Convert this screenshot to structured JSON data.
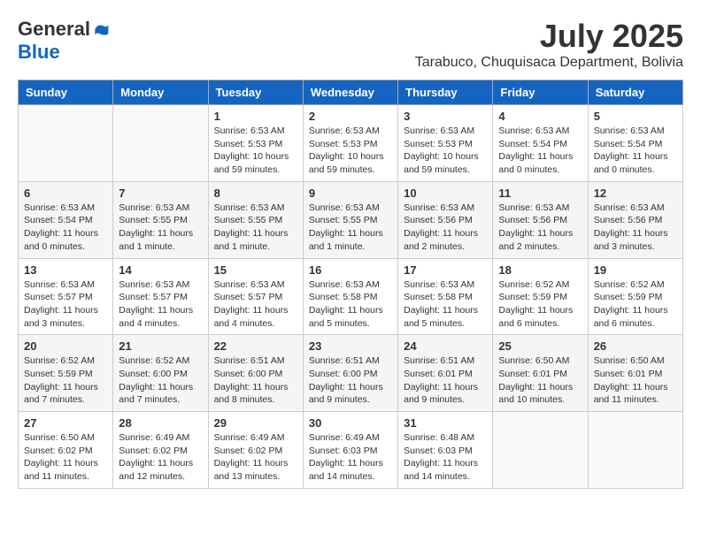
{
  "logo": {
    "general": "General",
    "blue": "Blue"
  },
  "title": {
    "month_year": "July 2025",
    "location": "Tarabuco, Chuquisaca Department, Bolivia"
  },
  "days_of_week": [
    "Sunday",
    "Monday",
    "Tuesday",
    "Wednesday",
    "Thursday",
    "Friday",
    "Saturday"
  ],
  "weeks": [
    [
      {
        "day": "",
        "sunrise": "",
        "sunset": "",
        "daylight": ""
      },
      {
        "day": "",
        "sunrise": "",
        "sunset": "",
        "daylight": ""
      },
      {
        "day": "1",
        "sunrise": "Sunrise: 6:53 AM",
        "sunset": "Sunset: 5:53 PM",
        "daylight": "Daylight: 10 hours and 59 minutes."
      },
      {
        "day": "2",
        "sunrise": "Sunrise: 6:53 AM",
        "sunset": "Sunset: 5:53 PM",
        "daylight": "Daylight: 10 hours and 59 minutes."
      },
      {
        "day": "3",
        "sunrise": "Sunrise: 6:53 AM",
        "sunset": "Sunset: 5:53 PM",
        "daylight": "Daylight: 10 hours and 59 minutes."
      },
      {
        "day": "4",
        "sunrise": "Sunrise: 6:53 AM",
        "sunset": "Sunset: 5:54 PM",
        "daylight": "Daylight: 11 hours and 0 minutes."
      },
      {
        "day": "5",
        "sunrise": "Sunrise: 6:53 AM",
        "sunset": "Sunset: 5:54 PM",
        "daylight": "Daylight: 11 hours and 0 minutes."
      }
    ],
    [
      {
        "day": "6",
        "sunrise": "Sunrise: 6:53 AM",
        "sunset": "Sunset: 5:54 PM",
        "daylight": "Daylight: 11 hours and 0 minutes."
      },
      {
        "day": "7",
        "sunrise": "Sunrise: 6:53 AM",
        "sunset": "Sunset: 5:55 PM",
        "daylight": "Daylight: 11 hours and 1 minute."
      },
      {
        "day": "8",
        "sunrise": "Sunrise: 6:53 AM",
        "sunset": "Sunset: 5:55 PM",
        "daylight": "Daylight: 11 hours and 1 minute."
      },
      {
        "day": "9",
        "sunrise": "Sunrise: 6:53 AM",
        "sunset": "Sunset: 5:55 PM",
        "daylight": "Daylight: 11 hours and 1 minute."
      },
      {
        "day": "10",
        "sunrise": "Sunrise: 6:53 AM",
        "sunset": "Sunset: 5:56 PM",
        "daylight": "Daylight: 11 hours and 2 minutes."
      },
      {
        "day": "11",
        "sunrise": "Sunrise: 6:53 AM",
        "sunset": "Sunset: 5:56 PM",
        "daylight": "Daylight: 11 hours and 2 minutes."
      },
      {
        "day": "12",
        "sunrise": "Sunrise: 6:53 AM",
        "sunset": "Sunset: 5:56 PM",
        "daylight": "Daylight: 11 hours and 3 minutes."
      }
    ],
    [
      {
        "day": "13",
        "sunrise": "Sunrise: 6:53 AM",
        "sunset": "Sunset: 5:57 PM",
        "daylight": "Daylight: 11 hours and 3 minutes."
      },
      {
        "day": "14",
        "sunrise": "Sunrise: 6:53 AM",
        "sunset": "Sunset: 5:57 PM",
        "daylight": "Daylight: 11 hours and 4 minutes."
      },
      {
        "day": "15",
        "sunrise": "Sunrise: 6:53 AM",
        "sunset": "Sunset: 5:57 PM",
        "daylight": "Daylight: 11 hours and 4 minutes."
      },
      {
        "day": "16",
        "sunrise": "Sunrise: 6:53 AM",
        "sunset": "Sunset: 5:58 PM",
        "daylight": "Daylight: 11 hours and 5 minutes."
      },
      {
        "day": "17",
        "sunrise": "Sunrise: 6:53 AM",
        "sunset": "Sunset: 5:58 PM",
        "daylight": "Daylight: 11 hours and 5 minutes."
      },
      {
        "day": "18",
        "sunrise": "Sunrise: 6:52 AM",
        "sunset": "Sunset: 5:59 PM",
        "daylight": "Daylight: 11 hours and 6 minutes."
      },
      {
        "day": "19",
        "sunrise": "Sunrise: 6:52 AM",
        "sunset": "Sunset: 5:59 PM",
        "daylight": "Daylight: 11 hours and 6 minutes."
      }
    ],
    [
      {
        "day": "20",
        "sunrise": "Sunrise: 6:52 AM",
        "sunset": "Sunset: 5:59 PM",
        "daylight": "Daylight: 11 hours and 7 minutes."
      },
      {
        "day": "21",
        "sunrise": "Sunrise: 6:52 AM",
        "sunset": "Sunset: 6:00 PM",
        "daylight": "Daylight: 11 hours and 7 minutes."
      },
      {
        "day": "22",
        "sunrise": "Sunrise: 6:51 AM",
        "sunset": "Sunset: 6:00 PM",
        "daylight": "Daylight: 11 hours and 8 minutes."
      },
      {
        "day": "23",
        "sunrise": "Sunrise: 6:51 AM",
        "sunset": "Sunset: 6:00 PM",
        "daylight": "Daylight: 11 hours and 9 minutes."
      },
      {
        "day": "24",
        "sunrise": "Sunrise: 6:51 AM",
        "sunset": "Sunset: 6:01 PM",
        "daylight": "Daylight: 11 hours and 9 minutes."
      },
      {
        "day": "25",
        "sunrise": "Sunrise: 6:50 AM",
        "sunset": "Sunset: 6:01 PM",
        "daylight": "Daylight: 11 hours and 10 minutes."
      },
      {
        "day": "26",
        "sunrise": "Sunrise: 6:50 AM",
        "sunset": "Sunset: 6:01 PM",
        "daylight": "Daylight: 11 hours and 11 minutes."
      }
    ],
    [
      {
        "day": "27",
        "sunrise": "Sunrise: 6:50 AM",
        "sunset": "Sunset: 6:02 PM",
        "daylight": "Daylight: 11 hours and 11 minutes."
      },
      {
        "day": "28",
        "sunrise": "Sunrise: 6:49 AM",
        "sunset": "Sunset: 6:02 PM",
        "daylight": "Daylight: 11 hours and 12 minutes."
      },
      {
        "day": "29",
        "sunrise": "Sunrise: 6:49 AM",
        "sunset": "Sunset: 6:02 PM",
        "daylight": "Daylight: 11 hours and 13 minutes."
      },
      {
        "day": "30",
        "sunrise": "Sunrise: 6:49 AM",
        "sunset": "Sunset: 6:03 PM",
        "daylight": "Daylight: 11 hours and 14 minutes."
      },
      {
        "day": "31",
        "sunrise": "Sunrise: 6:48 AM",
        "sunset": "Sunset: 6:03 PM",
        "daylight": "Daylight: 11 hours and 14 minutes."
      },
      {
        "day": "",
        "sunrise": "",
        "sunset": "",
        "daylight": ""
      },
      {
        "day": "",
        "sunrise": "",
        "sunset": "",
        "daylight": ""
      }
    ]
  ]
}
